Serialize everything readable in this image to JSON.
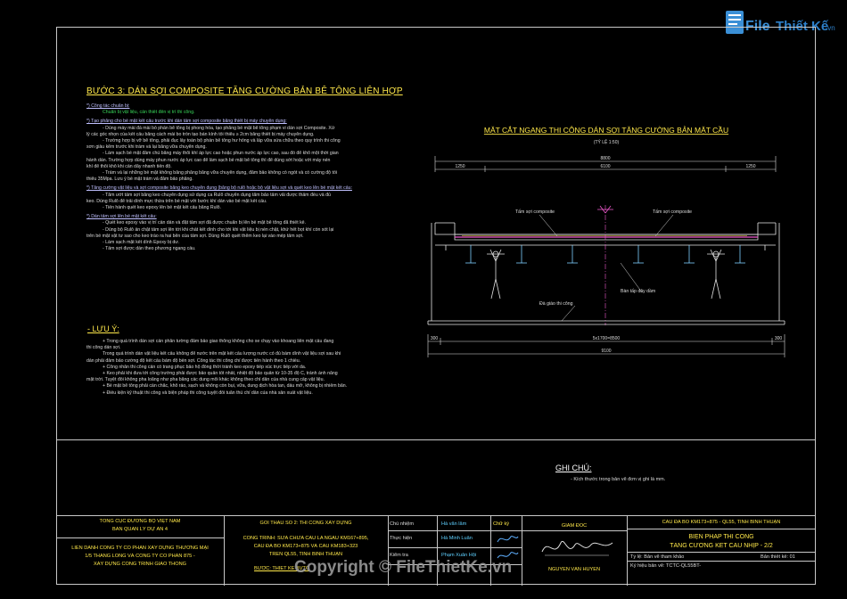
{
  "logo": {
    "text_file": "File",
    "text_main": "Thiết Kế",
    "text_domain": ".vn"
  },
  "watermark": "Copyright © FileThietKe.vn",
  "left_text": {
    "heading": "BƯỚC 3: DÁN SỢI COMPOSITE TĂNG CƯỜNG BẢN BÊ TÔNG LIÊN HỢP",
    "sections": [
      {
        "title": "*) Công tác chuẩn bị:",
        "lines": [
          "Chuẩn bị vật liệu, cần thiết đến vị trí thi công."
        ]
      },
      {
        "title": "*) Tạo phẳng cho bề mặt kết cấu trước khi dán tấm sợi composite bằng thiết bị máy chuyên dụng:",
        "lines": [
          "- Dùng máy mài đá mài bỏ phần bê tông bị phong hóa, tạo phẳng bề mặt bê tông phạm vi dán sợi Composite. Xử",
          "lý các góc nhọn của kết cấu bằng cách mài bo tròn tạo bán kính tối thiểu ≥ 2cm bằng thiết bị máy chuyên dụng.",
          "- Trường hợp bị vỡ bê tông, phải đục lấy toàn bộ phần bê tông hư hỏng và lấp vữa sửa chữa theo quy trình thi công",
          "sơn giàu kẽm trước khi trám vá lại bằng vữa chuyên dụng.",
          "- Làm sạch bề mặt đảm chủ bằng máy thổi khí áp lực cao hoặc phun nước áp lực cao, sau đó để khô một thời gian",
          "hành dán. Trường hợp dùng máy phun nước áp lực cao để làm sạch bề mặt bê tông thì để dùng sớt hoặc với máy nén",
          "khí để thổi khô khi cần dây nhanh tiến độ.",
          "- Trám vá lại những bề mặt không bằng phẳng bằng vữa chuyên dụng, đảm bảo không có ngót và có cường độ tối",
          "thiểu 35Mpa. Lưu ý bề mặt trám vá đảm bảo phẳng."
        ]
      },
      {
        "title": "*) Tăng cường vật liệu và sợi composite bằng keo chuyên dụng (bằng bộ rulô hoặc bộ vật liệu sợi và quét keo lên bề mặt kết cấu:",
        "lines": [
          "- Tăm ướt tấm sợi bằng keo chuyên dụng sử dụng ca Rulô chuyên dụng tẩm bảo tấm vải được thấm đều và đủ",
          "keo. Dùng Rulô để trải dính mực thừa trên bề mặt với bước khí dán vào bề mặt kết cấu.",
          "- Tiến hành quét keo epoxy lên bề mặt kết cấu bằng Rulô."
        ]
      },
      {
        "title": "*) Dán tấm sợi lên bề mặt kết cấu:",
        "lines": [
          "- Quét keo epoxy vào vị trí cần dán và đặt tấm sợi đã được chuẩn bị lên bề mặt bê tông đã thiết kế.",
          "- Dùng bộ Rulô ấn chặt tấm sợi lên tới khi chất kết dính cho tới khi vật liệu bị nén chặt, khử hết bọt khí còn sót lại",
          "trên bề mặt vật tư sao cho keo trào ra hai bên của tấm sợi. Dùng Rulô quét thêm keo lại vào mép tấm sợi.",
          "- Làm sạch mặt kết dính Epoxy bị dư.",
          "- Tấm sợi được dán theo phương ngang cầu."
        ]
      }
    ],
    "note_heading": "- LƯU Ý:",
    "note_lines": [
      "+ Trong quá trình dán sợi cần phân tường đảm bảo giao thông không cho xe chạy vào khoang liên mặt cầu đang",
      "thi công dán sợi.",
      "Trong quá trình dán vật liệu kết cấu không để nước trên mặt kết cấu lượng nước có đủ bám dính vật liệu sợi sau khi",
      "dán phải đảm bảo cường độ kết cấu bám độ bền sợi. Công tác thi công chỉ được tiến hành theo 1 chiều.",
      "+ Công nhân thi công cần có trang phục bảo hộ đồng thời tránh keo epoxy tiếp xúc trực tiếp với da.",
      "+ Keo phải khi đưa tới công trường phải được bảo quản tốt nhất, nhiệt độ bảo quản từ 10-35 độ C, tránh ánh nắng",
      "mặt trời. Tuyệt đối không pha loãng như pha bằng các dung môi khác không theo chỉ dẫn của nhà cung cấp vật liệu.",
      "+ Bề mặt bê tông phải cần chắc, khô ráo, sạch và không còn bụi, vữa, dung dịch hòa tan, dầu mỡ, không bị nhiễm bẩn.",
      "+ Điều kiện kỹ thuật thi công và biện pháp thi công tuyệt đối tuân thủ chỉ dẫn của nhà sản xuất vật liệu."
    ]
  },
  "drawing": {
    "title": "MẶT CẮT NGANG THI CÔNG DÁN SỢI TĂNG CƯỜNG BẢN MẶT CẦU",
    "scale": "(TỶ LỆ 1:50)",
    "dim_total_top": "8800",
    "dim_left": "1250",
    "dim_mid": "6100",
    "dim_right": "1250",
    "dim_bottom_left": "300",
    "dim_bottom_mid": "5x1700=8500",
    "dim_bottom_right": "300",
    "dim_bottom_total": "9100",
    "label_sheet_left": "Tấm sợi composite",
    "label_sheet_right": "Tấm sợi composite",
    "label_support": "Bàn tấp dây dầm",
    "label_scaffold": "Đà giáo thi công"
  },
  "ghi_chu": {
    "title": "GHI CHÚ:",
    "text": "- Kích thước trong bản vẽ đơn vị ghi là mm."
  },
  "title_block": {
    "owner": "TỔNG CỤC ĐƯỜNG BỘ VIỆT NAM",
    "owner2": "BAN QUẢN LÝ DỰ ÁN 4",
    "contractor": "LIÊN DANH CÔNG TY CỔ PHẦN XÂY DỰNG THƯƠNG MẠI",
    "contractor2": "1/5 THĂNG LONG VÀ CÔNG TY CỔ PHẦN 875 -",
    "contractor3": "XÂY DỰNG CÔNG TRÌNH GIAO THÔNG",
    "package": "GÓI THẦU SỐ 2: THI CÔNG XÂY DỰNG",
    "project": "CÔNG TRÌNH: SỬA CHỮA CẦU LA NGÀU KM167+895,",
    "project2": "CẦU ĐA BỐ KM173+875 VÀ CẦU KM183+323",
    "project3": "TRÊN QL55, TỈNH BÌNH THUẬN",
    "stage": "BƯỚC: THIẾT KẾ BVTC",
    "roles": [
      "Chủ nhiệm",
      "Thực hiện",
      "Kiểm tra"
    ],
    "names": [
      "Hà văn lâm",
      "Hà Minh Luân",
      "Phạm Xuân Hội"
    ],
    "sign_header": "Chữ ký",
    "director_header": "GIÁM ĐỐC",
    "director": "NGUYỄN VĂN HUYỀN",
    "bridge": "CẦU ĐA BỐ KM173+875 - QL55, TỈNH BÌNH THUẬN",
    "drawing_title1": "BIỆN PHÁP THI CÔNG",
    "drawing_title2": "TĂNG CƯỜNG KẾT CẤU NHỊP - 2/2",
    "ratio": "Tỷ lệ: Bản vẽ tham khảo",
    "sheet_no": "Bản thiết kế: 01",
    "drawing_no": "Ký hiệu bản vẽ: TCTC-QL55BT-"
  }
}
